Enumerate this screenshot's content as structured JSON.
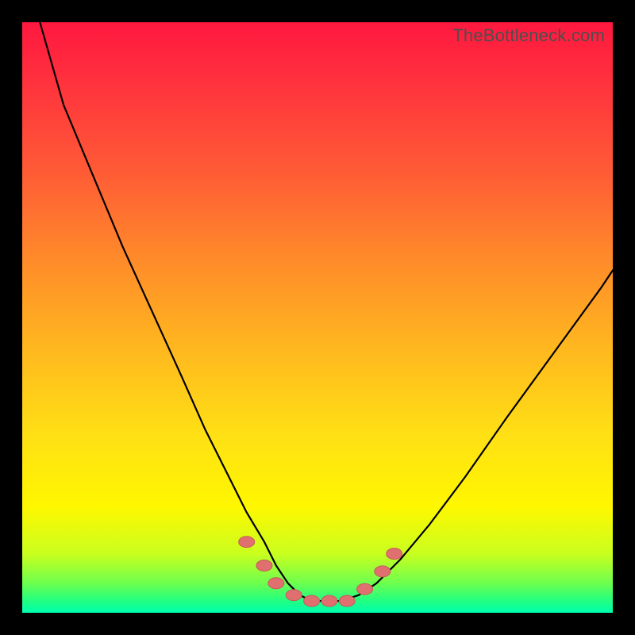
{
  "watermark": "TheBottleneck.com",
  "colors": {
    "frame": "#000000",
    "gradient_top": "#ff183f",
    "gradient_bottom": "#00ffb0",
    "curve": "#000000",
    "dots": "#e07070"
  },
  "chart_data": {
    "type": "line",
    "title": "",
    "xlabel": "",
    "ylabel": "",
    "xlim": [
      0,
      100
    ],
    "ylim": [
      0,
      100
    ],
    "x": [
      0,
      3,
      7,
      12,
      17,
      22,
      27,
      31,
      35,
      38,
      41,
      43,
      45,
      47,
      49,
      51,
      54,
      57,
      60,
      64,
      69,
      75,
      82,
      90,
      98,
      100
    ],
    "values": [
      120,
      100,
      86,
      74,
      62,
      51,
      40,
      31,
      23,
      17,
      12,
      8,
      5,
      3,
      2,
      2,
      2,
      3,
      5,
      9,
      15,
      23,
      33,
      44,
      55,
      58
    ],
    "annotations": [
      {
        "x": 38,
        "y": 12,
        "kind": "dot"
      },
      {
        "x": 41,
        "y": 8,
        "kind": "dot"
      },
      {
        "x": 43,
        "y": 5,
        "kind": "dot"
      },
      {
        "x": 46,
        "y": 3,
        "kind": "dot"
      },
      {
        "x": 49,
        "y": 2,
        "kind": "dot"
      },
      {
        "x": 52,
        "y": 2,
        "kind": "dot"
      },
      {
        "x": 55,
        "y": 2,
        "kind": "dot"
      },
      {
        "x": 58,
        "y": 4,
        "kind": "dot"
      },
      {
        "x": 61,
        "y": 7,
        "kind": "dot"
      },
      {
        "x": 63,
        "y": 10,
        "kind": "dot"
      }
    ]
  }
}
